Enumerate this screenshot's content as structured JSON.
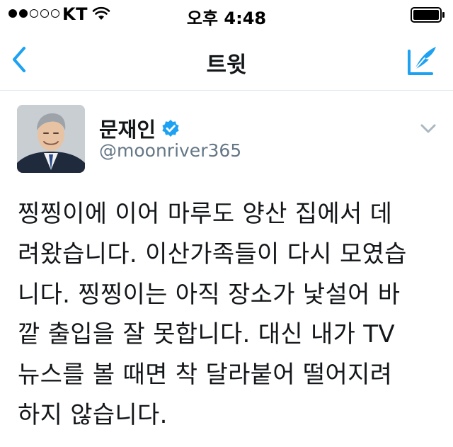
{
  "status_bar": {
    "carrier": "KT",
    "time": "오후 4:48",
    "signal_full": 2,
    "signal_total": 5
  },
  "nav": {
    "title": "트윗",
    "back_icon": "chevron-left-icon",
    "compose_icon": "compose-feather-icon"
  },
  "tweet": {
    "author": {
      "display_name": "문재인",
      "handle": "@moonriver365",
      "verified": true
    },
    "text": "찡찡이에 이어 마루도 양산 집에서 데\n려왔습니다. 이산가족들이 다시 모였습\n니다. 찡찡이는 아직 장소가 낯설어 바\n깥 출입을 잘 못합니다. 대신 내가 TV\n뉴스를 볼 때면 착 달라붙어 떨어지려\n하지 않습니다."
  },
  "colors": {
    "accent": "#1da1f2",
    "text_primary": "#14171a",
    "text_secondary": "#657786",
    "divider": "#e1e8ed"
  }
}
